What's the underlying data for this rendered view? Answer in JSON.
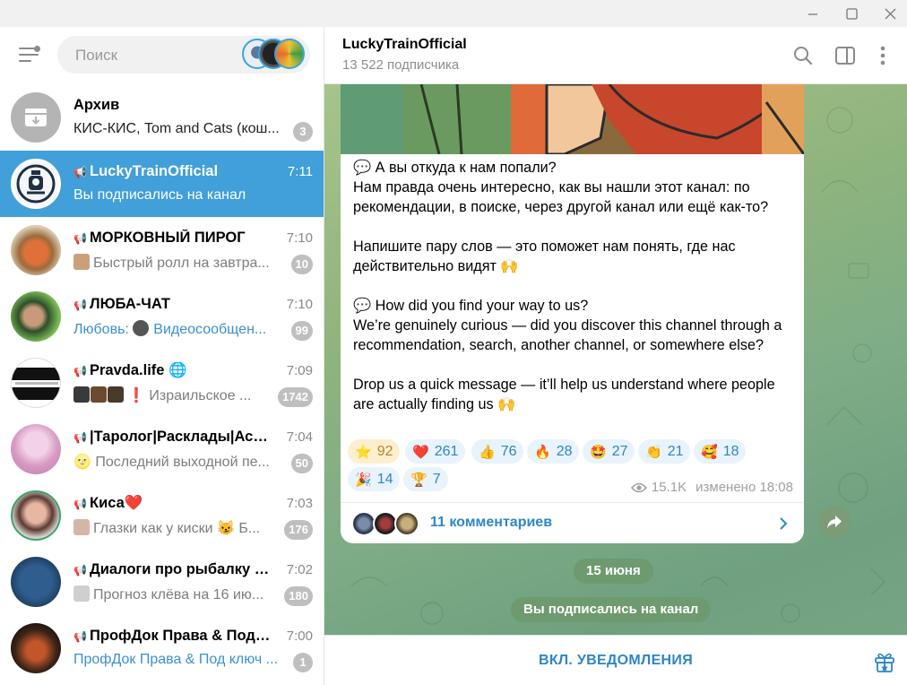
{
  "window": {
    "minimize": "–",
    "maximize": "☐",
    "close": "✕"
  },
  "search": {
    "placeholder": "Поиск"
  },
  "chats": [
    {
      "name": "Архив",
      "preview_sender": "КИС-КИС",
      "preview_text": ", Tom and Cats (кош...",
      "badge": "3",
      "time": ""
    },
    {
      "name": "LuckyTrainOfficial",
      "preview_text": "Вы подписались на канал",
      "time": "7:11",
      "badge": ""
    },
    {
      "name": "МОРКОВНЫЙ ПИРОГ",
      "preview_text": "Быстрый ролл на завтра...",
      "time": "7:10",
      "badge": "10"
    },
    {
      "name": "ЛЮБА-ЧАТ",
      "preview_sender": "Любовь: ",
      "preview_text": "Видеосообщен...",
      "time": "7:10",
      "badge": "99"
    },
    {
      "name": "Pravda.life 🌐",
      "preview_text": "❗ Израильское ...",
      "time": "7:09",
      "badge": "1742"
    },
    {
      "name": "|Таролог|Расклады|Аст...",
      "preview_text": "🌝 Последний выходной пе...",
      "time": "7:04",
      "badge": "50"
    },
    {
      "name": "Киса❤️",
      "preview_text": "Глазки как у киски 😼 Б...",
      "time": "7:03",
      "badge": "176"
    },
    {
      "name": "Диалоги про рыбалку | ...",
      "preview_text": "Прогноз клёва на 16 ию...",
      "time": "7:02",
      "badge": "180"
    },
    {
      "name": "ПрофДок Права & Под к...",
      "preview_sender": "ПрофДок Права & Под ключ ...",
      "preview_text": "",
      "time": "7:00",
      "badge": "1"
    }
  ],
  "header": {
    "title": "LuckyTrainOfficial",
    "subtitle": "13 522 подписчика"
  },
  "post": {
    "p1_q": "💬 А вы откуда к нам попали?",
    "p1_body": "Нам правда очень интересно, как вы нашли этот канал: по рекомендации, в поиске, через другой канал или ещё как-то?",
    "p2": "Напишите пару слов — это поможет нам понять, где нас действительно видят 🙌",
    "p3_q": "💬 How did you find your way to us?",
    "p3_body": "We’re genuinely curious — did you discover this channel through a recommendation, search, another channel, or somewhere else?",
    "p4": "Drop us a quick message — it’ll help us understand where people are actually finding us 🙌",
    "reactions": [
      {
        "emoji": "⭐",
        "count": "92"
      },
      {
        "emoji": "❤️",
        "count": "261"
      },
      {
        "emoji": "👍",
        "count": "76"
      },
      {
        "emoji": "🔥",
        "count": "28"
      },
      {
        "emoji": "🤩",
        "count": "27"
      },
      {
        "emoji": "👏",
        "count": "21"
      },
      {
        "emoji": "🥰",
        "count": "18"
      },
      {
        "emoji": "🎉",
        "count": "14"
      },
      {
        "emoji": "🏆",
        "count": "7"
      }
    ],
    "views": "15.1K",
    "edited": "изменено 18:08",
    "comments": "11 комментариев"
  },
  "date_separator": "15 июня",
  "service_message": "Вы подписались на канал",
  "bottom_button": "ВКЛ. УВЕДОМЛЕНИЯ",
  "colors": {
    "accent": "#419fd9",
    "link": "#2e86c5",
    "badge": "#bfbfbf",
    "pill": "#6e9a70"
  }
}
